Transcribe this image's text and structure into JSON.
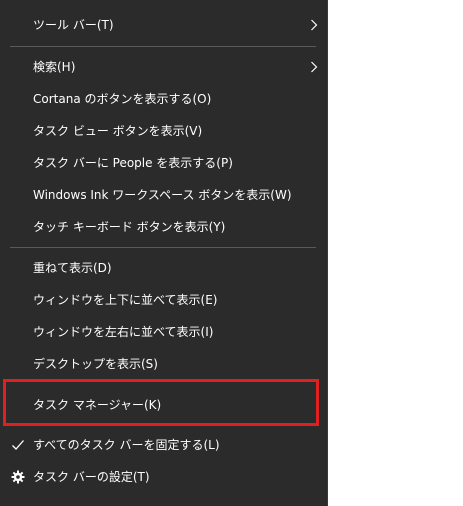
{
  "menu": {
    "items": [
      {
        "label": "ツール バー(T)",
        "submenu": true
      },
      {
        "label": "検索(H)",
        "submenu": true
      },
      {
        "label": "Cortana のボタンを表示する(O)"
      },
      {
        "label": "タスク ビュー ボタンを表示(V)"
      },
      {
        "label": "タスク バーに People を表示する(P)"
      },
      {
        "label": "Windows Ink ワークスペース ボタンを表示(W)"
      },
      {
        "label": "タッチ キーボード ボタンを表示(Y)"
      },
      {
        "label": "重ねて表示(D)"
      },
      {
        "label": "ウィンドウを上下に並べて表示(E)"
      },
      {
        "label": "ウィンドウを左右に並べて表示(I)"
      },
      {
        "label": "デスクトップを表示(S)"
      },
      {
        "label": "タスク マネージャー(K)",
        "highlighted": true
      },
      {
        "label": "すべてのタスク バーを固定する(L)",
        "checked": true,
        "icon": "checkmark-icon"
      },
      {
        "label": "タスク バーの設定(T)",
        "icon": "gear-icon"
      }
    ]
  },
  "colors": {
    "menu_background": "#2b2b2b",
    "separator": "#5a5a5a",
    "text": "#ffffff",
    "highlight_border": "#e02020"
  }
}
